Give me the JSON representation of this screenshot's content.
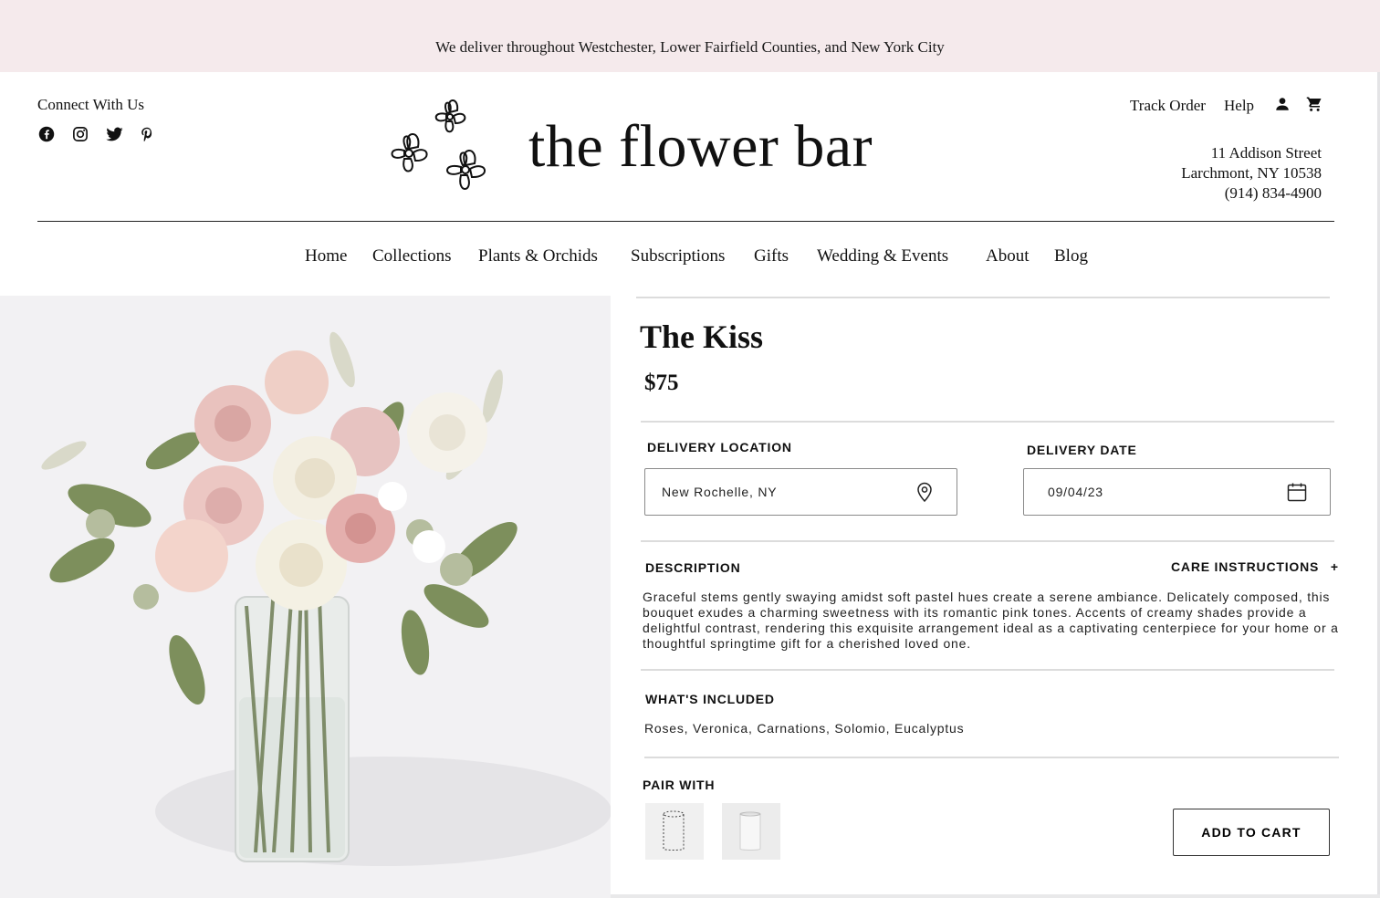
{
  "banner": {
    "text": "We deliver throughout Westchester,  Lower Fairfield Counties, and New York City"
  },
  "header": {
    "connect_title": "Connect With Us",
    "social_icons": [
      "facebook-icon",
      "instagram-icon",
      "twitter-icon",
      "pinterest-icon"
    ],
    "brand": "the flower bar",
    "track_order": "Track Order",
    "help": "Help",
    "address": {
      "line1": "11 Addison Street",
      "line2": "Larchmont, NY 10538",
      "phone": "(914) 834-4900"
    }
  },
  "nav": {
    "items": [
      "Home",
      "Collections",
      "Plants & Orchids",
      "Subscriptions",
      "Gifts",
      "Wedding & Events",
      "About",
      "Blog"
    ]
  },
  "product": {
    "title": "The Kiss",
    "price": "$75",
    "delivery_location_label": "DELIVERY LOCATION",
    "delivery_location_value": "New Rochelle, NY",
    "delivery_date_label": "DELIVERY DATE",
    "delivery_date_value": "09/04/23",
    "description_label": "DESCRIPTION",
    "care_label": "CARE INSTRUCTIONS",
    "care_toggle": "+",
    "description": "Graceful stems gently swaying amidst soft pastel hues create a serene ambiance. Delicately composed, this bouquet exudes a charming sweetness with its romantic pink tones. Accents of creamy shades provide a delightful contrast, rendering this exquisite arrangement ideal as a captivating centerpiece for your home or a thoughtful springtime gift for a cherished loved one.",
    "included_label": "WHAT'S INCLUDED",
    "included": "Roses, Veronica, Carnations, Solomio, Eucalyptus",
    "pair_label": "PAIR WITH",
    "add_to_cart": "ADD TO CART"
  },
  "colors": {
    "banner_bg": "#f5eaec",
    "hero_bg": "#f2f1f3",
    "text": "#111111",
    "divider": "#dcdcdc"
  }
}
